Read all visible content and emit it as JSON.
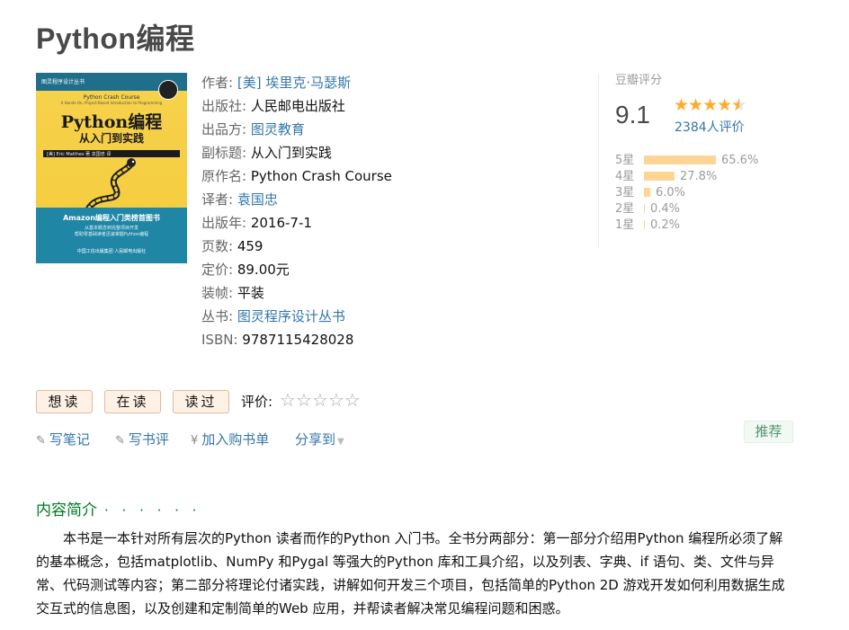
{
  "book": {
    "title": "Python编程"
  },
  "cover": {
    "publisher_tag": "图灵程序设计丛书",
    "en_title": "Python Crash Course",
    "en_subtitle": "A Hands-On, Project-Based Introduction to Programming",
    "cn_title": "Python编程",
    "cn_subtitle": "从入门到实践",
    "author_line": "[美] Eric Matthes 著   袁国忠 译",
    "promo": "Amazon编程入门类榜首图书",
    "promo_sub1": "从基本概念到完整项目开发",
    "promo_sub2": "帮助零基础读者迅速掌握Python编程",
    "logos": "中国工信出版集团   人民邮电出版社"
  },
  "info": {
    "author_label": "作者:",
    "author_value": "[美] 埃里克·马瑟斯",
    "publisher_label": "出版社:",
    "publisher_value": "人民邮电出版社",
    "producer_label": "出品方:",
    "producer_value": "图灵教育",
    "subtitle_label": "副标题:",
    "subtitle_value": "从入门到实践",
    "original_label": "原作名:",
    "original_value": "Python Crash Course",
    "translator_label": "译者:",
    "translator_value": "袁国忠",
    "year_label": "出版年:",
    "year_value": "2016-7-1",
    "pages_label": "页数:",
    "pages_value": "459",
    "price_label": "定价:",
    "price_value": "89.00元",
    "binding_label": "装帧:",
    "binding_value": "平装",
    "series_label": "丛书:",
    "series_value": "图灵程序设计丛书",
    "isbn_label": "ISBN:",
    "isbn_value": "9787115428028"
  },
  "rating": {
    "title": "豆瓣评分",
    "score": "9.1",
    "stars_value": 4.5,
    "count": "2384人评价",
    "distribution": [
      {
        "label": "5星",
        "pct": "65.6%",
        "value": 65.6
      },
      {
        "label": "4星",
        "pct": "27.8%",
        "value": 27.8
      },
      {
        "label": "3星",
        "pct": "6.0%",
        "value": 6.0
      },
      {
        "label": "2星",
        "pct": "0.4%",
        "value": 0.4
      },
      {
        "label": "1星",
        "pct": "0.2%",
        "value": 0.2
      }
    ]
  },
  "actions": {
    "want_read": "想读",
    "reading": "在读",
    "read": "读过",
    "eval_label": "评价:",
    "write_note": "写笔记",
    "write_review": "写书评",
    "add_cart": "加入购书单",
    "share": "分享到",
    "recommend": "推荐"
  },
  "intro": {
    "heading": "内容简介",
    "dots": "· · · · · ·",
    "text": "本书是一本针对所有层次的Python 读者而作的Python 入门书。全书分两部分：第一部分介绍用Python 编程所必须了解的基本概念，包括matplotlib、NumPy 和Pygal 等强大的Python 库和工具介绍，以及列表、字典、if 语句、类、文件与异常、代码测试等内容；第二部分将理论付诸实践，讲解如何开发三个项目，包括简单的Python 2D 游戏开发如何利用数据生成交互式的信息图，以及创建和定制简单的Web 应用，并帮读者解决常见编程问题和困惑。"
  },
  "colors": {
    "link": "#3377aa",
    "green": "#007722",
    "star": "#ffac2d",
    "bar": "#ffd596"
  }
}
